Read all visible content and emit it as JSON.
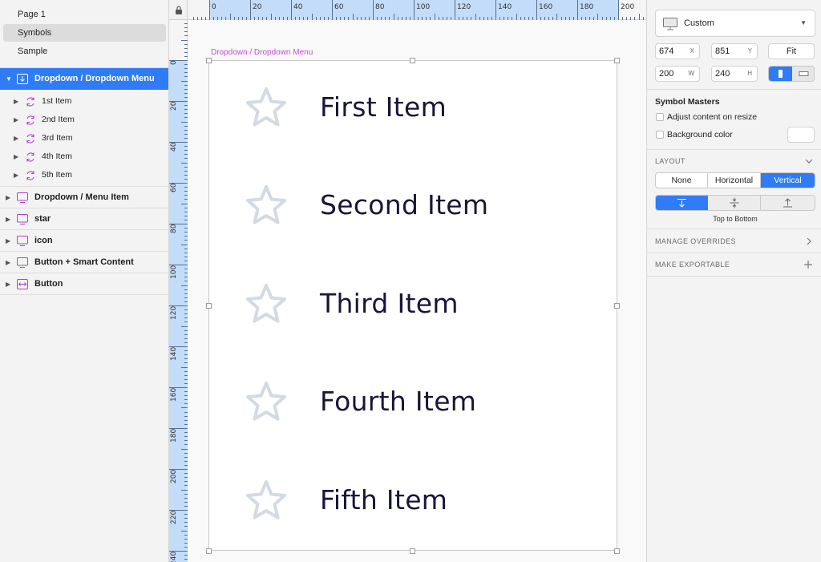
{
  "pages": [
    "Page 1",
    "Symbols",
    "Sample"
  ],
  "active_page_index": 1,
  "layers": {
    "selected": "Dropdown / Dropdown Menu",
    "children": [
      "1st Item",
      "2nd Item",
      "3rd Item",
      "4th Item",
      "5th Item"
    ],
    "others": [
      "Dropdown / Menu Item",
      "star",
      "icon",
      "Button + Smart Content",
      "Button"
    ]
  },
  "canvas": {
    "artboard_label": "Dropdown / Dropdown Menu",
    "ruler_top_labels": [
      "0",
      "20",
      "40",
      "60",
      "80",
      "100",
      "120",
      "140",
      "160",
      "180",
      "200"
    ],
    "ruler_left_labels": [
      "0",
      "20",
      "40",
      "60",
      "80",
      "100",
      "120",
      "140",
      "160",
      "180",
      "200",
      "220",
      "240"
    ],
    "items": [
      "First Item",
      "Second Item",
      "Third Item",
      "Fourth Item",
      "Fifth Item"
    ]
  },
  "inspector": {
    "preset": "Custom",
    "x": "674",
    "x_label": "X",
    "y": "851",
    "y_label": "Y",
    "w": "200",
    "w_label": "W",
    "h": "240",
    "h_label": "H",
    "fit_label": "Fit",
    "symbol_masters_title": "Symbol Masters",
    "adjust_content_label": "Adjust content on resize",
    "background_color_label": "Background color",
    "layout_title": "LAYOUT",
    "layout_options": [
      "None",
      "Horizontal",
      "Vertical"
    ],
    "layout_selected": "Vertical",
    "align_caption": "Top to Bottom",
    "manage_overrides": "MANAGE OVERRIDES",
    "make_exportable": "MAKE EXPORTABLE"
  },
  "colors": {
    "accent": "#2f7cf6",
    "artboard_label": "#c44fd6",
    "item_text": "#181538",
    "star_stroke": "#d3dae3",
    "symbol_icon": "#b23fd1"
  }
}
